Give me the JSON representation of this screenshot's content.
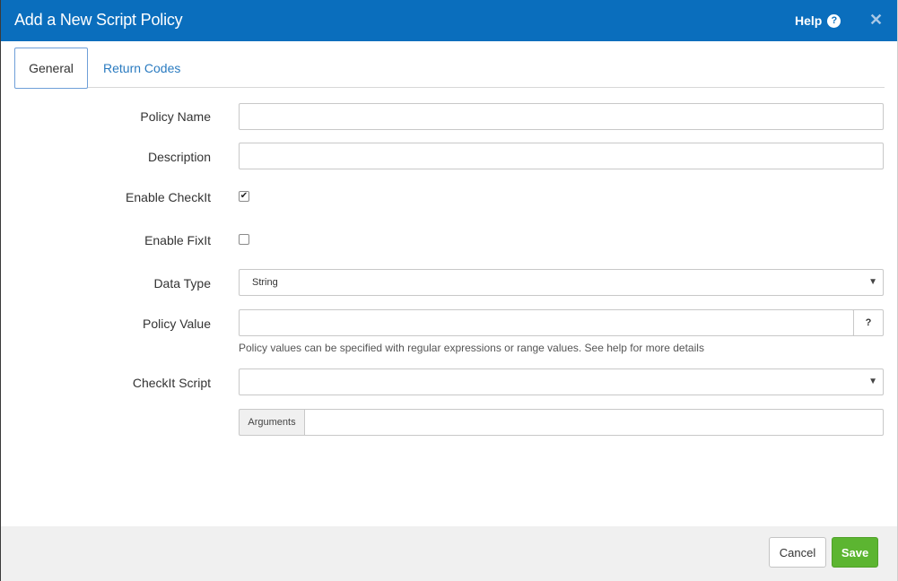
{
  "dialog": {
    "title": "Add a New Script Policy",
    "help_label": "Help",
    "help_icon": "question-circle-icon",
    "close_icon": "close-icon",
    "colors": {
      "header": "#0a6ebd",
      "accent": "#2a7bc0",
      "save": "#5cb531"
    }
  },
  "tabs": [
    {
      "label": "General",
      "active": true
    },
    {
      "label": "Return Codes",
      "active": false
    }
  ],
  "form": {
    "policy_name": {
      "label": "Policy Name",
      "value": ""
    },
    "description": {
      "label": "Description",
      "value": ""
    },
    "enable_checkit": {
      "label": "Enable CheckIt",
      "checked": true
    },
    "enable_fixit": {
      "label": "Enable FixIt",
      "checked": false
    },
    "data_type": {
      "label": "Data Type",
      "value": "String"
    },
    "policy_value": {
      "label": "Policy Value",
      "value": "",
      "help_button": "?",
      "hint": "Policy values can be specified with regular expressions or range values. See help for more details"
    },
    "checkit_script": {
      "label": "CheckIt Script",
      "value": ""
    },
    "arguments": {
      "addon": "Arguments",
      "value": ""
    }
  },
  "footer": {
    "cancel_label": "Cancel",
    "save_label": "Save"
  }
}
